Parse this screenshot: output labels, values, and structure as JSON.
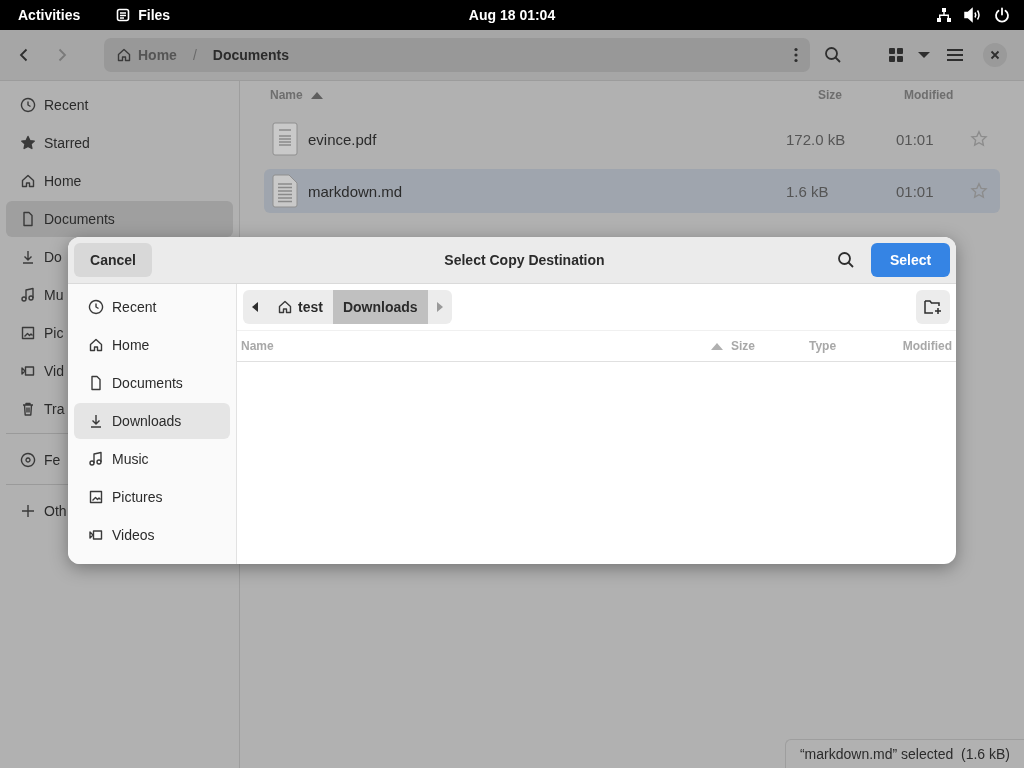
{
  "top_bar": {
    "activities": "Activities",
    "app_name": "Files",
    "clock": "Aug 18  01:04"
  },
  "files_window": {
    "path": [
      {
        "label": "Home",
        "kind": "home"
      },
      {
        "label": "Documents"
      }
    ],
    "path_separator": "/",
    "sidebar": {
      "groups": [
        {
          "items": [
            {
              "label": "Recent",
              "kind": "recent",
              "selected": false
            },
            {
              "label": "Starred",
              "kind": "starred",
              "selected": false
            },
            {
              "label": "Home",
              "kind": "home",
              "selected": false
            },
            {
              "label": "Documents",
              "kind": "documents",
              "selected": true
            },
            {
              "label": "Do",
              "kind": "downloads",
              "selected": false
            },
            {
              "label": "Mu",
              "kind": "music",
              "selected": false
            },
            {
              "label": "Pic",
              "kind": "pictures",
              "selected": false
            },
            {
              "label": "Vid",
              "kind": "videos",
              "selected": false
            },
            {
              "label": "Tra",
              "kind": "trash",
              "selected": false
            }
          ]
        },
        {
          "items": [
            {
              "label": "Fe",
              "kind": "disc",
              "selected": false
            }
          ]
        },
        {
          "items": [
            {
              "label": "Oth",
              "kind": "plus",
              "selected": false
            }
          ]
        }
      ]
    },
    "columns": {
      "name": "Name",
      "size": "Size",
      "modified": "Modified"
    },
    "rows": [
      {
        "name": "evince.pdf",
        "kind": "pdf",
        "size": "172.0 kB",
        "modified": "01:01",
        "selected": false
      },
      {
        "name": "markdown.md",
        "kind": "text",
        "size": "1.6 kB",
        "modified": "01:01",
        "selected": true
      }
    ],
    "status": "“markdown.md” selected  (1.6 kB)"
  },
  "dialog": {
    "title": "Select Copy Destination",
    "cancel": "Cancel",
    "select": "Select",
    "sidebar": [
      {
        "label": "Recent",
        "kind": "recent",
        "selected": false
      },
      {
        "label": "Home",
        "kind": "home",
        "selected": false
      },
      {
        "label": "Documents",
        "kind": "documents",
        "selected": false
      },
      {
        "label": "Downloads",
        "kind": "downloads",
        "selected": true
      },
      {
        "label": "Music",
        "kind": "music",
        "selected": false
      },
      {
        "label": "Pictures",
        "kind": "pictures",
        "selected": false
      },
      {
        "label": "Videos",
        "kind": "videos",
        "selected": false
      }
    ],
    "breadcrumbs": [
      {
        "label": "test",
        "kind": "home",
        "selected": false
      },
      {
        "label": "Downloads",
        "selected": true
      }
    ],
    "columns": [
      "Name",
      "Size",
      "Type",
      "Modified"
    ]
  }
}
